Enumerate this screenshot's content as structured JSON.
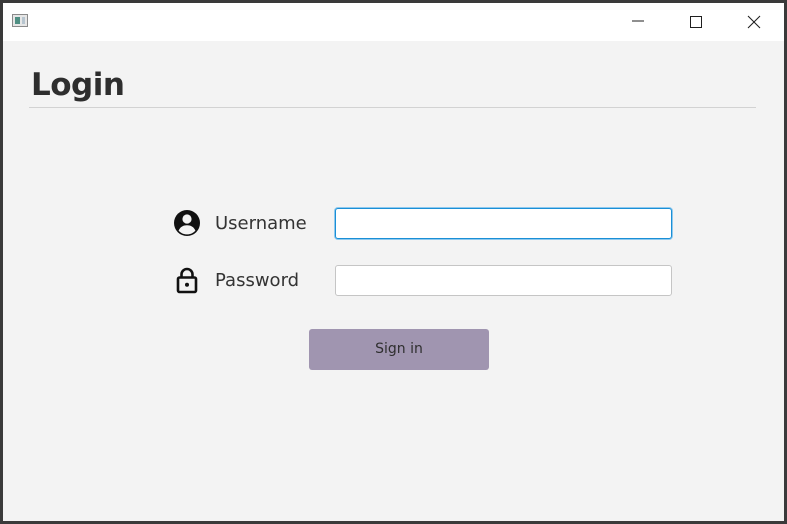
{
  "window": {
    "title": "",
    "icons": {
      "app": "app-window-icon",
      "minimize": "minimize-icon",
      "maximize": "maximize-icon",
      "close": "close-icon"
    }
  },
  "page": {
    "heading": "Login"
  },
  "form": {
    "username": {
      "icon": "user-circle-icon",
      "label": "Username",
      "value": "",
      "placeholder": ""
    },
    "password": {
      "icon": "lock-icon",
      "label": "Password",
      "value": "",
      "placeholder": ""
    },
    "submit_label": "Sign in"
  },
  "colors": {
    "button_background": "#a095b0",
    "focus_border": "#1a8fd6",
    "window_background": "#f3f3f3"
  }
}
